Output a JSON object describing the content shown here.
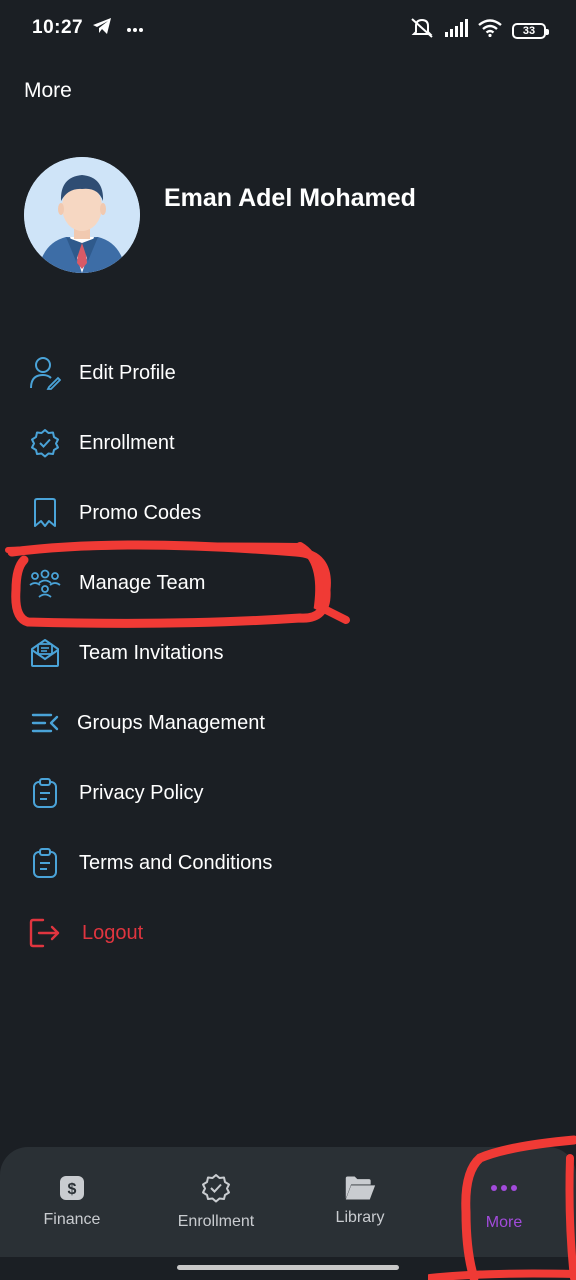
{
  "status_bar": {
    "time": "10:27",
    "battery": "33"
  },
  "header": {
    "title": "More"
  },
  "profile": {
    "name": "Eman Adel Mohamed"
  },
  "menu": {
    "items": [
      {
        "label": "Edit Profile",
        "icon": "user-edit-icon"
      },
      {
        "label": "Enrollment",
        "icon": "badge-check-icon"
      },
      {
        "label": "Promo Codes",
        "icon": "bookmark-icon"
      },
      {
        "label": "Manage Team",
        "icon": "team-icon"
      },
      {
        "label": "Team Invitations",
        "icon": "mail-icon"
      },
      {
        "label": "Groups Management",
        "icon": "menu-collapse-icon"
      },
      {
        "label": "Privacy Policy",
        "icon": "clipboard-icon"
      },
      {
        "label": "Terms and Conditions",
        "icon": "clipboard-icon"
      },
      {
        "label": "Logout",
        "icon": "logout-icon"
      }
    ]
  },
  "bottom_nav": {
    "items": [
      {
        "label": "Finance",
        "icon": "dollar-icon"
      },
      {
        "label": "Enrollment",
        "icon": "badge-check-icon"
      },
      {
        "label": "Library",
        "icon": "folder-open-icon"
      },
      {
        "label": "More",
        "icon": "dots-icon",
        "active": true
      }
    ]
  },
  "colors": {
    "background": "#1b1f24",
    "icon_accent": "#4aa3d8",
    "logout": "#e0353f",
    "active_nav": "#a24bdb",
    "annotation": "#f03a35"
  }
}
